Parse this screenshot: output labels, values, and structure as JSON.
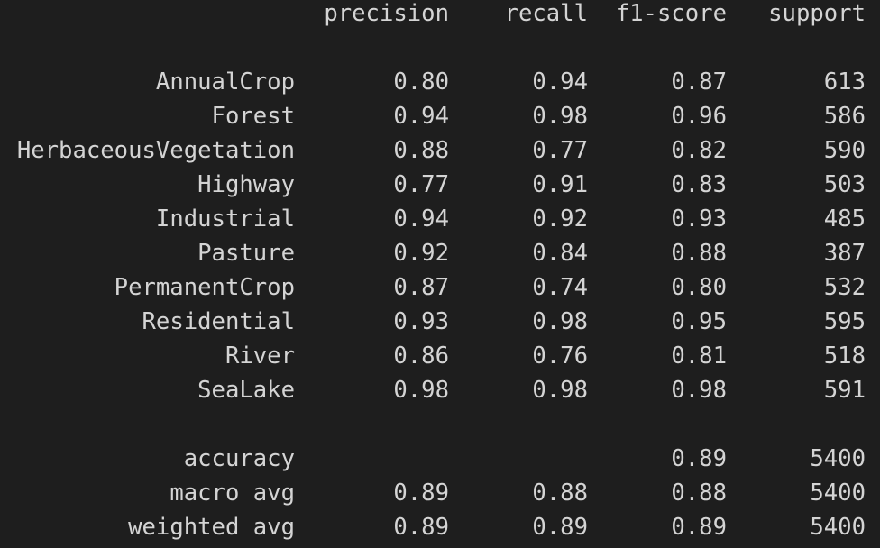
{
  "report": {
    "header": [
      "precision",
      "recall",
      "f1-score",
      "support"
    ],
    "classes": [
      {
        "label": "AnnualCrop",
        "precision": "0.80",
        "recall": "0.94",
        "f1": "0.87",
        "support": "613"
      },
      {
        "label": "Forest",
        "precision": "0.94",
        "recall": "0.98",
        "f1": "0.96",
        "support": "586"
      },
      {
        "label": "HerbaceousVegetation",
        "precision": "0.88",
        "recall": "0.77",
        "f1": "0.82",
        "support": "590"
      },
      {
        "label": "Highway",
        "precision": "0.77",
        "recall": "0.91",
        "f1": "0.83",
        "support": "503"
      },
      {
        "label": "Industrial",
        "precision": "0.94",
        "recall": "0.92",
        "f1": "0.93",
        "support": "485"
      },
      {
        "label": "Pasture",
        "precision": "0.92",
        "recall": "0.84",
        "f1": "0.88",
        "support": "387"
      },
      {
        "label": "PermanentCrop",
        "precision": "0.87",
        "recall": "0.74",
        "f1": "0.80",
        "support": "532"
      },
      {
        "label": "Residential",
        "precision": "0.93",
        "recall": "0.98",
        "f1": "0.95",
        "support": "595"
      },
      {
        "label": "River",
        "precision": "0.86",
        "recall": "0.76",
        "f1": "0.81",
        "support": "518"
      },
      {
        "label": "SeaLake",
        "precision": "0.98",
        "recall": "0.98",
        "f1": "0.98",
        "support": "591"
      }
    ],
    "summary": [
      {
        "label": "accuracy",
        "precision": "",
        "recall": "",
        "f1": "0.89",
        "support": "5400"
      },
      {
        "label": "macro avg",
        "precision": "0.89",
        "recall": "0.88",
        "f1": "0.88",
        "support": "5400"
      },
      {
        "label": "weighted avg",
        "precision": "0.89",
        "recall": "0.89",
        "f1": "0.89",
        "support": "5400"
      }
    ]
  },
  "colors": {
    "background": "#1e1e1e",
    "text": "#d4d4d4"
  }
}
